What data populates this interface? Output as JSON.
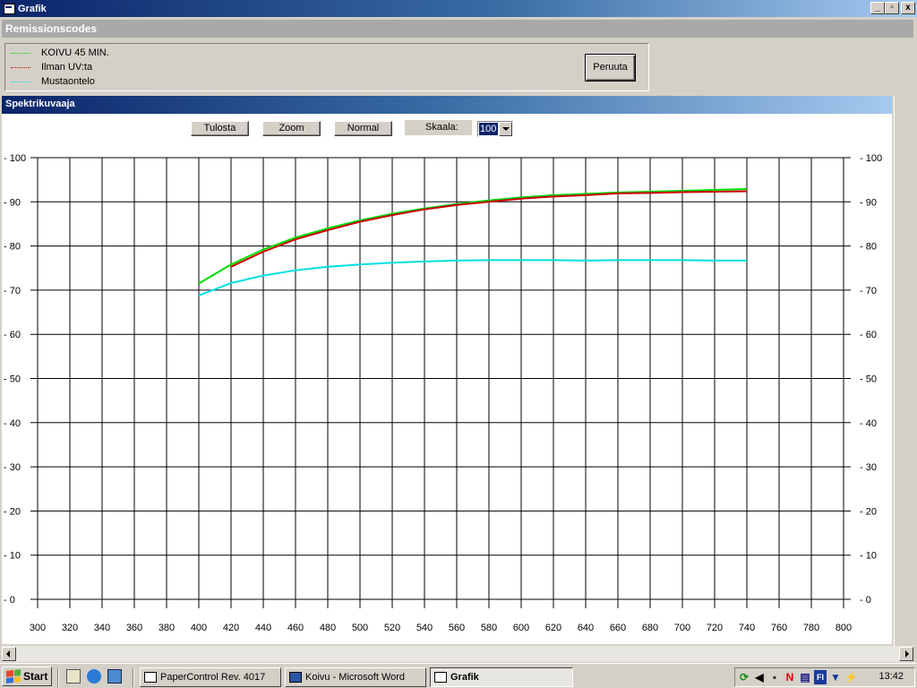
{
  "window": {
    "title": "Grafik",
    "controls": [
      "_",
      "▫",
      "x"
    ]
  },
  "remission": {
    "header": "Remissionscodes",
    "legend": [
      {
        "label": "KOIVU 45 MIN.",
        "color": "#00dd00"
      },
      {
        "label": "Ilman UV:ta",
        "color": "#cc0000"
      },
      {
        "label": "Mustaontelo",
        "color": "#00e0e0"
      }
    ],
    "cancel_label": "Peruuta"
  },
  "graph": {
    "header": "Spektrikuvaaja",
    "toolbar": {
      "print_label": "Tulosta",
      "zoom_label": "Zoom",
      "normal_label": "Normal",
      "scale_label": "Skaala:",
      "scale_value": "100"
    }
  },
  "chart_data": {
    "type": "line",
    "title": "",
    "xlabel": "",
    "ylabel": "",
    "xlim": [
      300,
      800
    ],
    "ylim": [
      0,
      100
    ],
    "xticks": [
      300,
      320,
      340,
      360,
      380,
      400,
      420,
      440,
      460,
      480,
      500,
      520,
      540,
      560,
      580,
      600,
      620,
      640,
      660,
      680,
      700,
      720,
      740,
      760,
      780,
      800
    ],
    "yticks": [
      0,
      10,
      20,
      30,
      40,
      50,
      60,
      70,
      80,
      90,
      100
    ],
    "grid": true,
    "x": [
      400,
      420,
      440,
      460,
      480,
      500,
      520,
      540,
      560,
      580,
      600,
      620,
      640,
      660,
      680,
      700,
      720,
      740
    ],
    "series": [
      {
        "name": "KOIVU 45 MIN.",
        "color": "#00dd00",
        "values": [
          71.5,
          75.8,
          79.2,
          81.9,
          84.0,
          85.8,
          87.3,
          88.5,
          89.5,
          90.3,
          91.0,
          91.5,
          91.8,
          92.1,
          92.3,
          92.5,
          92.7,
          92.9
        ]
      },
      {
        "name": "Ilman UV:ta",
        "color": "#cc0000",
        "values": [
          null,
          75.3,
          78.7,
          81.5,
          83.6,
          85.5,
          87.0,
          88.3,
          89.3,
          90.0,
          90.7,
          91.2,
          91.5,
          91.9,
          92.0,
          92.2,
          92.3,
          92.4
        ]
      },
      {
        "name": "Mustaontelo",
        "color": "#00e0e0",
        "values": [
          68.8,
          71.6,
          73.3,
          74.5,
          75.3,
          75.8,
          76.2,
          76.5,
          76.7,
          76.8,
          76.8,
          76.8,
          76.7,
          76.8,
          76.8,
          76.8,
          76.7,
          76.7
        ]
      }
    ]
  },
  "taskbar": {
    "start_label": "Start",
    "items": [
      {
        "label": "PaperControl  Rev. 4017",
        "active": false
      },
      {
        "label": "Koivu - Microsoft Word",
        "active": false
      },
      {
        "label": "Grafik",
        "active": true
      }
    ],
    "clock": "13:42"
  }
}
